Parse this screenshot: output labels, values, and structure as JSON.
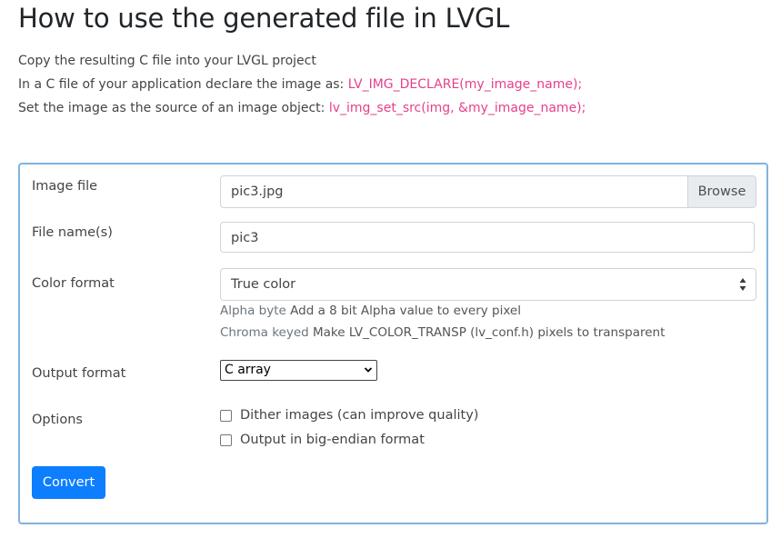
{
  "heading": "How to use the generated file in LVGL",
  "instructions": {
    "line1": "Copy the resulting C file into your LVGL project",
    "line2_text": "In a C file of your application declare the image as: ",
    "line2_code": "LV_IMG_DECLARE(my_image_name);",
    "line3_text": "Set the image as the source of an image object: ",
    "line3_code": "lv_img_set_src(img, &my_image_name);"
  },
  "form": {
    "image_file": {
      "label": "Image file",
      "value": "pic3.jpg",
      "browse_label": "Browse"
    },
    "file_names": {
      "label": "File name(s)",
      "value": "pic3"
    },
    "color_format": {
      "label": "Color format",
      "selected": "True color",
      "help": [
        {
          "term": "Alpha byte",
          "desc": "Add a 8 bit Alpha value to every pixel"
        },
        {
          "term": "Chroma keyed",
          "desc": "Make LV_COLOR_TRANSP (lv_conf.h) pixels to transparent"
        }
      ]
    },
    "output_format": {
      "label": "Output format",
      "selected": "C array"
    },
    "options": {
      "label": "Options",
      "items": [
        {
          "label": "Dither images (can improve quality)",
          "checked": false
        },
        {
          "label": "Output in big-endian format",
          "checked": false
        }
      ]
    },
    "convert_label": "Convert"
  },
  "colors": {
    "accent": "#0d7efe",
    "code": "#e83e8c",
    "card_border": "#80b3e0"
  }
}
